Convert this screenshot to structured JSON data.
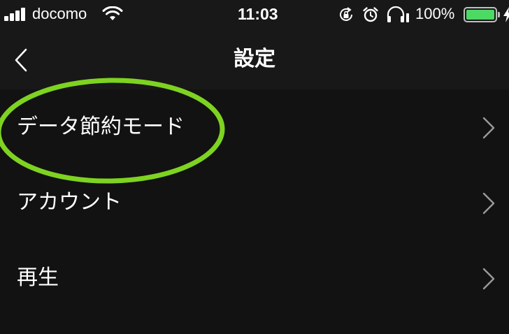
{
  "status_bar": {
    "carrier": "docomo",
    "time": "11:03",
    "battery_percent": "100%",
    "battery_level": 1.0,
    "signal_bars": 4,
    "icons": [
      "signal-icon",
      "wifi-icon",
      "orientation-lock-icon",
      "alarm-icon",
      "headphones-icon",
      "battery-icon",
      "charging-bolt-icon"
    ]
  },
  "nav": {
    "title": "設定",
    "back_icon": "chevron-left-icon"
  },
  "settings": {
    "items": [
      {
        "label": "データ節約モード",
        "icon": "chevron-right-icon",
        "highlighted": true
      },
      {
        "label": "アカウント",
        "icon": "chevron-right-icon",
        "highlighted": false
      },
      {
        "label": "再生",
        "icon": "chevron-right-icon",
        "highlighted": false
      }
    ]
  },
  "colors": {
    "background": "#121212",
    "bar_background": "#181818",
    "text": "#ffffff",
    "chevron": "#9a9a9a",
    "highlight": "#7ed321",
    "battery_fill": "#4cd964"
  }
}
